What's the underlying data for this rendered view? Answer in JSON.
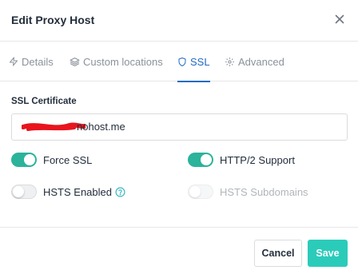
{
  "modal": {
    "title": "Edit Proxy Host",
    "close_label": "×"
  },
  "tabs": [
    {
      "label": "Details",
      "icon": "zap-icon",
      "active": false
    },
    {
      "label": "Custom locations",
      "icon": "layers-icon",
      "active": false
    },
    {
      "label": "SSL",
      "icon": "shield-icon",
      "active": true
    },
    {
      "label": "Advanced",
      "icon": "gear-icon",
      "active": false
    }
  ],
  "ssl": {
    "certificate_label": "SSL Certificate",
    "certificate_value_visible": "nohost.me",
    "redaction_color": "#e8141e"
  },
  "options": {
    "force_ssl": {
      "label": "Force SSL",
      "enabled": true
    },
    "http2": {
      "label": "HTTP/2 Support",
      "enabled": true
    },
    "hsts": {
      "label": "HSTS Enabled",
      "enabled": false
    },
    "hsts_subdomains": {
      "label": "HSTS Subdomains",
      "enabled": false,
      "disabled": true
    }
  },
  "footer": {
    "cancel_label": "Cancel",
    "save_label": "Save"
  },
  "colors": {
    "accent": "#206bc4",
    "toggle_on": "#2bb39b",
    "save_button": "#2bcbba"
  }
}
